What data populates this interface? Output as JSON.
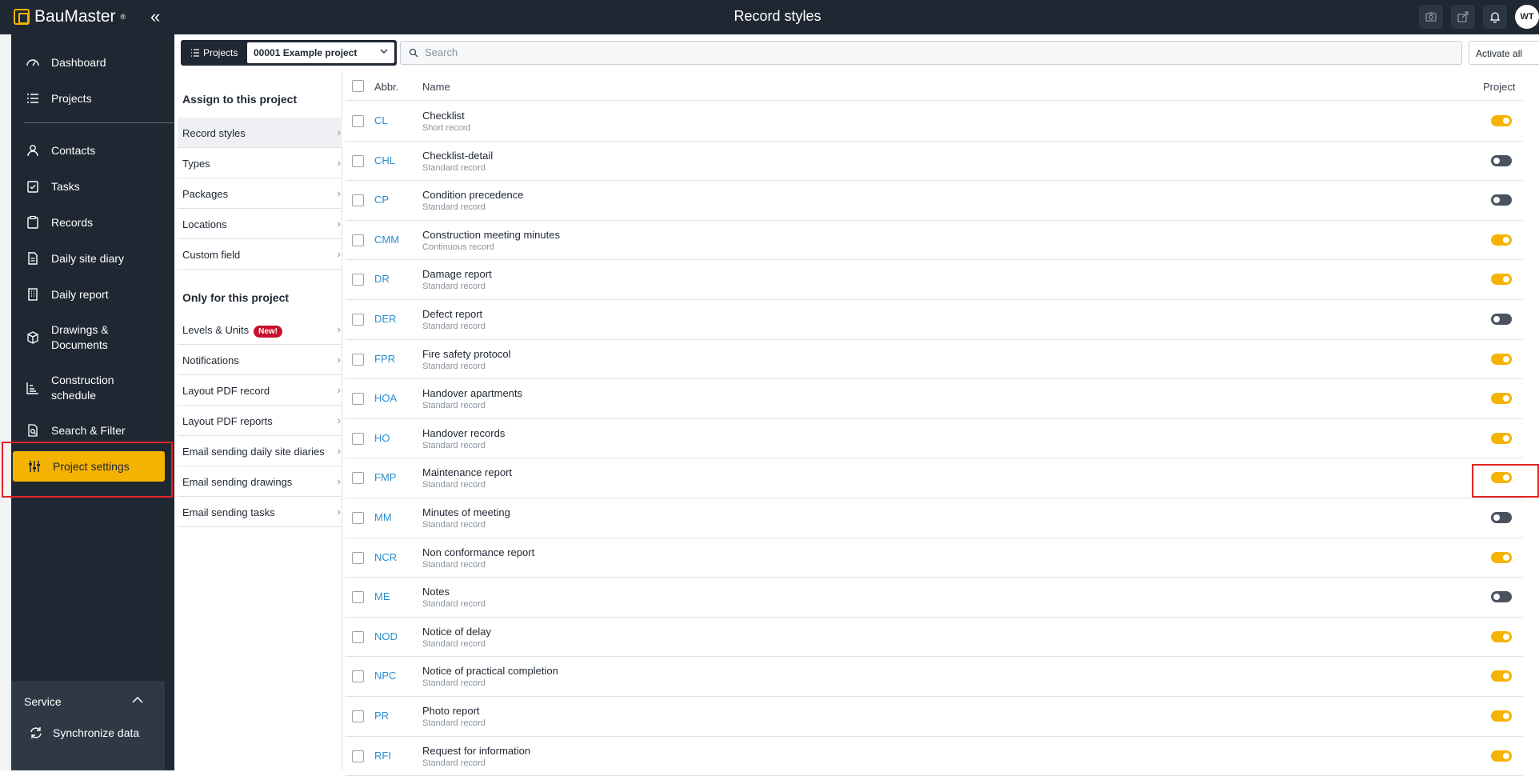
{
  "app": {
    "brand": "BauMaster",
    "brand_mark": "®",
    "collapse_glyph": "«",
    "page_title": "Record styles",
    "avatar_initials": "WT"
  },
  "sidebar": {
    "items": [
      {
        "label": "Dashboard",
        "icon": "dashboard-icon"
      },
      {
        "label": "Projects",
        "icon": "list-icon"
      },
      {
        "label": "Contacts",
        "icon": "person-icon"
      },
      {
        "label": "Tasks",
        "icon": "task-icon"
      },
      {
        "label": "Records",
        "icon": "clipboard-icon"
      },
      {
        "label": "Daily site diary",
        "icon": "document-icon"
      },
      {
        "label": "Daily report",
        "icon": "building-icon"
      },
      {
        "label": "Drawings & Documents",
        "icon": "cube-icon"
      },
      {
        "label": "Construction schedule",
        "icon": "chart-icon"
      },
      {
        "label": "Search & Filter",
        "icon": "search-filter-icon"
      },
      {
        "label": "Project settings",
        "icon": "sliders-icon"
      }
    ],
    "active_index": 10,
    "service_label": "Service",
    "sync_label": "Synchronize data"
  },
  "toolbar": {
    "projects_label": "Projects",
    "project_value": "00001 Example project",
    "search_placeholder": "Search",
    "activate_label": "Activate all"
  },
  "midpanel": {
    "assign_heading": "Assign to this project",
    "assign_items": [
      "Record styles",
      "Types",
      "Packages",
      "Locations",
      "Custom field"
    ],
    "only_heading": "Only for this project",
    "only_items": [
      "Levels & Units",
      "Notifications",
      "Layout PDF record",
      "Layout PDF reports",
      "Email sending daily site diaries",
      "Email sending drawings",
      "Email sending tasks"
    ],
    "new_badge": "New!"
  },
  "table": {
    "headers": {
      "abbr": "Abbr.",
      "name": "Name",
      "project": "Project"
    },
    "rows": [
      {
        "abbr": "CL",
        "name": "Checklist",
        "sub": "Short record",
        "on": true
      },
      {
        "abbr": "CHL",
        "name": "Checklist-detail",
        "sub": "Standard record",
        "on": false
      },
      {
        "abbr": "CP",
        "name": "Condition precedence",
        "sub": "Standard record",
        "on": false
      },
      {
        "abbr": "CMM",
        "name": "Construction meeting minutes",
        "sub": "Continuous record",
        "on": true
      },
      {
        "abbr": "DR",
        "name": "Damage report",
        "sub": "Standard record",
        "on": true
      },
      {
        "abbr": "DER",
        "name": "Defect report",
        "sub": "Standard record",
        "on": false
      },
      {
        "abbr": "FPR",
        "name": "Fire safety protocol",
        "sub": "Standard record",
        "on": true
      },
      {
        "abbr": "HOA",
        "name": "Handover apartments",
        "sub": "Standard record",
        "on": true
      },
      {
        "abbr": "HO",
        "name": "Handover records",
        "sub": "Standard record",
        "on": true
      },
      {
        "abbr": "FMP",
        "name": "Maintenance report",
        "sub": "Standard record",
        "on": true
      },
      {
        "abbr": "MM",
        "name": "Minutes of meeting",
        "sub": "Standard record",
        "on": false
      },
      {
        "abbr": "NCR",
        "name": "Non conformance report",
        "sub": "Standard record",
        "on": true
      },
      {
        "abbr": "ME",
        "name": "Notes",
        "sub": "Standard record",
        "on": false
      },
      {
        "abbr": "NOD",
        "name": "Notice of delay",
        "sub": "Standard record",
        "on": true
      },
      {
        "abbr": "NPC",
        "name": "Notice of practical completion",
        "sub": "Standard record",
        "on": true
      },
      {
        "abbr": "PR",
        "name": "Photo report",
        "sub": "Standard record",
        "on": true
      },
      {
        "abbr": "RFI",
        "name": "Request for information",
        "sub": "Standard record",
        "on": true
      }
    ]
  },
  "colors": {
    "accent": "#f5b301",
    "sidebar": "#1f2733",
    "link": "#2a8fd0",
    "highlight": "#e02424"
  }
}
